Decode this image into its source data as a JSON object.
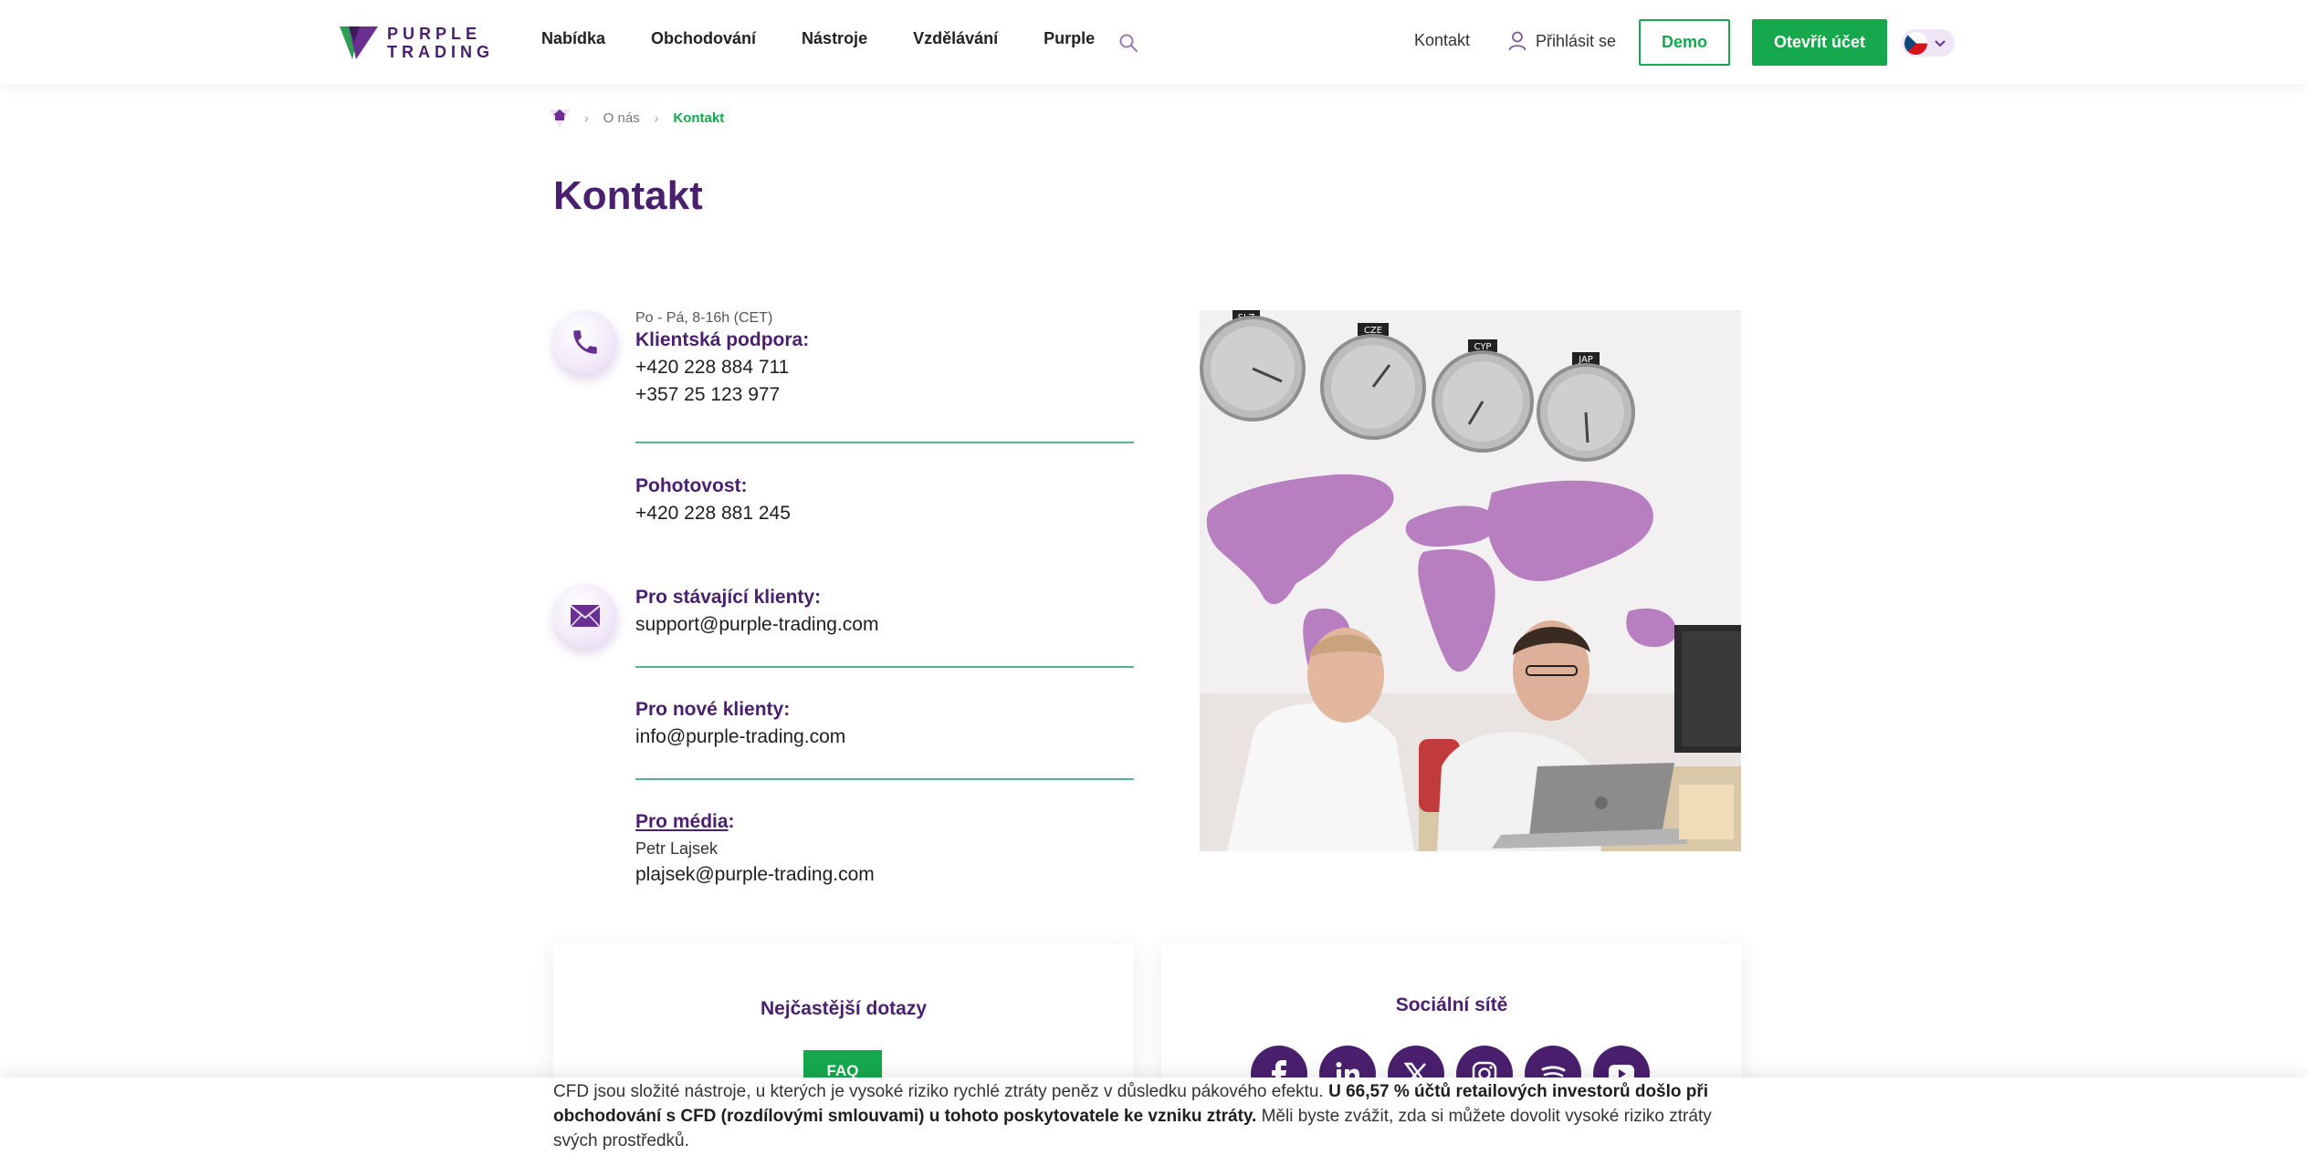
{
  "header": {
    "logo_line1": "PURPLE",
    "logo_line2": "TRADING",
    "nav": [
      "Nabídka",
      "Obchodování",
      "Nástroje",
      "Vzdělávání",
      "Purple"
    ],
    "search_icon": "search-icon",
    "contact_link": "Kontakt",
    "login_label": "Přihlásit se",
    "demo_label": "Demo",
    "open_account_label": "Otevřít účet",
    "language": "CZ"
  },
  "breadcrumb": {
    "home_icon": "home-icon",
    "items": [
      "O nás",
      "Kontakt"
    ]
  },
  "page_title": "Kontakt",
  "contacts": {
    "support_hours": "Po - Pá, 8-16h (CET)",
    "support_label": "Klientská podpora:",
    "support_phones": [
      "+420 228 884 711",
      "+357 25 123 977"
    ],
    "emergency_label": "Pohotovost:",
    "emergency_phone": "+420 228 881 245",
    "existing_label": "Pro stávající klienty:",
    "existing_email": "support@purple-trading.com",
    "new_label": "Pro nové klienty:",
    "new_email": "info@purple-trading.com",
    "media_label": "Pro média",
    "media_colon": ":",
    "media_person": "Petr Lajsek",
    "media_email": "plajsek@purple-trading.com"
  },
  "photo": {
    "clock_labels": [
      "SLZ",
      "CZE",
      "CYP",
      "JAP"
    ]
  },
  "cards": {
    "faq_title": "Nejčastější dotazy",
    "faq_button": "FAQ",
    "social_title": "Sociální sítě",
    "social_icons": [
      "facebook-icon",
      "linkedin-icon",
      "x-icon",
      "instagram-icon",
      "spotify-icon",
      "youtube-icon"
    ]
  },
  "risk": {
    "text1": "CFD jsou složité nástroje, u kterých je vysoké riziko rychlé ztráty peněz v důsledku pákového efektu. ",
    "bold": "U 66,57 % účtů retailových investorů došlo při obchodování s CFD (rozdílovými smlouvami) u tohoto poskytovatele ke vzniku ztráty.",
    "text2": " Měli byste zvážit, zda si můžete dovolit vysoké riziko ztráty svých prostředků."
  },
  "colors": {
    "brand_purple": "#4a1f6e",
    "accent_green": "#15a84d",
    "divider_green": "#5bb091",
    "map_purple": "#b77ec0"
  }
}
